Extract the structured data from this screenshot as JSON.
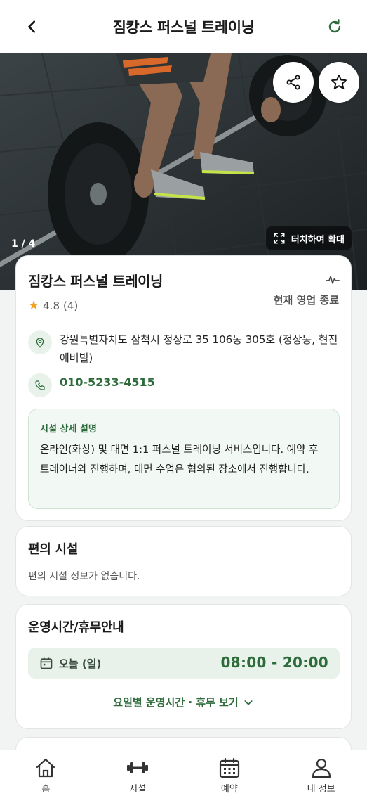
{
  "header": {
    "title": "짐캉스 퍼스널 트레이닝",
    "back_icon": "chevron-left-icon",
    "refresh_icon": "refresh-icon"
  },
  "hero": {
    "counter": "1 / 4",
    "zoom_label": "터치하여 확대",
    "share_icon": "share-icon",
    "favorite_icon": "star-outline-icon"
  },
  "facility": {
    "name": "짐캉스 퍼스널 트레이닝",
    "rating": "4.8",
    "review_count": "(4)",
    "status": "현재 영업 종료",
    "address": "강원특별자치도 삼척시 정상로 35 106동 305호 (정상동, 현진에버빌)",
    "phone": "010-5233-4515",
    "description_label": "시설 상세 설명",
    "description": "온라인(화상) 및 대면 1:1 퍼스널 트레이닝 서비스입니다. 예약 후 트레이너와 진행하며, 대면 수업은 협의된 장소에서 진행합니다."
  },
  "amenities": {
    "title": "편의 시설",
    "empty_text": "편의 시설 정보가 없습니다."
  },
  "hours": {
    "title": "운영시간/휴무안내",
    "today_label": "오늘 (일)",
    "today_time": "08:00 - 20:00",
    "more_label": "요일별 운영시간 · 휴무 보기"
  },
  "tabbar": {
    "items": [
      {
        "label": "홈",
        "icon": "home-icon"
      },
      {
        "label": "시설",
        "icon": "dumbbell-icon"
      },
      {
        "label": "예약",
        "icon": "calendar-icon"
      },
      {
        "label": "내 정보",
        "icon": "user-icon"
      }
    ]
  },
  "colors": {
    "accent": "#2d6b3b",
    "accent_light": "#e8f2ea",
    "star": "#f2a01f"
  }
}
